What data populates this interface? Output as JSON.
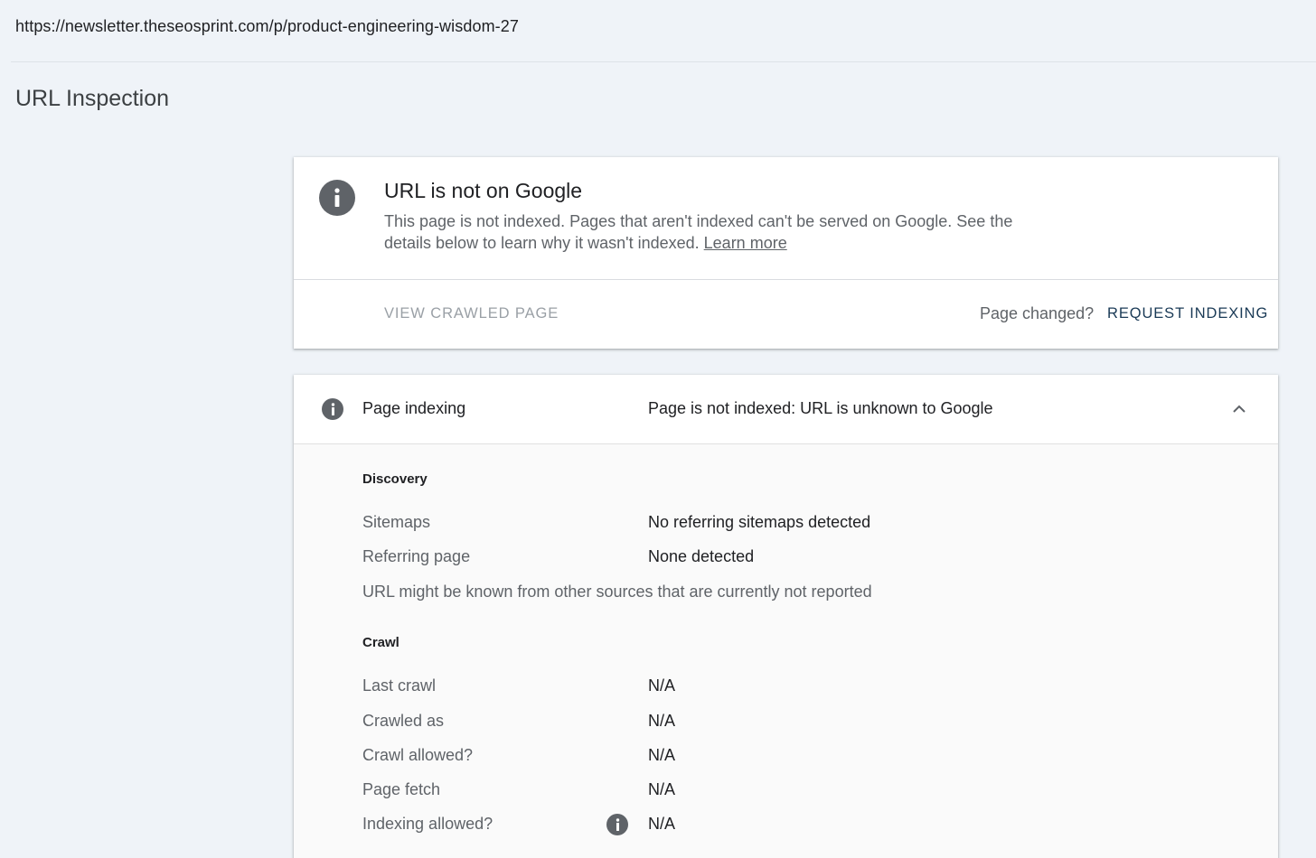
{
  "url_bar": {
    "url": "https://newsletter.theseosprint.com/p/product-engineering-wisdom-27"
  },
  "page_title": "URL Inspection",
  "status_card": {
    "icon": "info-icon",
    "title": "URL is not on Google",
    "description": "This page is not indexed. Pages that aren't indexed can't be served on Google. See the details below to learn why it wasn't indexed.",
    "learn_more": "Learn more",
    "view_crawled_page": "VIEW CRAWLED PAGE",
    "page_changed": "Page changed?",
    "request_indexing": "REQUEST INDEXING"
  },
  "indexing_card": {
    "label": "Page indexing",
    "value": "Page is not indexed: URL is unknown to Google",
    "expanded_icon": "chevron-up-icon",
    "discovery": {
      "title": "Discovery",
      "rows": [
        {
          "label": "Sitemaps",
          "value": "No referring sitemaps detected"
        },
        {
          "label": "Referring page",
          "value": "None detected"
        }
      ],
      "note": "URL might be known from other sources that are currently not reported"
    },
    "crawl": {
      "title": "Crawl",
      "rows": [
        {
          "label": "Last crawl",
          "value": "N/A"
        },
        {
          "label": "Crawled as",
          "value": "N/A"
        },
        {
          "label": "Crawl allowed?",
          "value": "N/A"
        },
        {
          "label": "Page fetch",
          "value": "N/A"
        },
        {
          "label": "Indexing allowed?",
          "value": "N/A"
        }
      ]
    }
  }
}
